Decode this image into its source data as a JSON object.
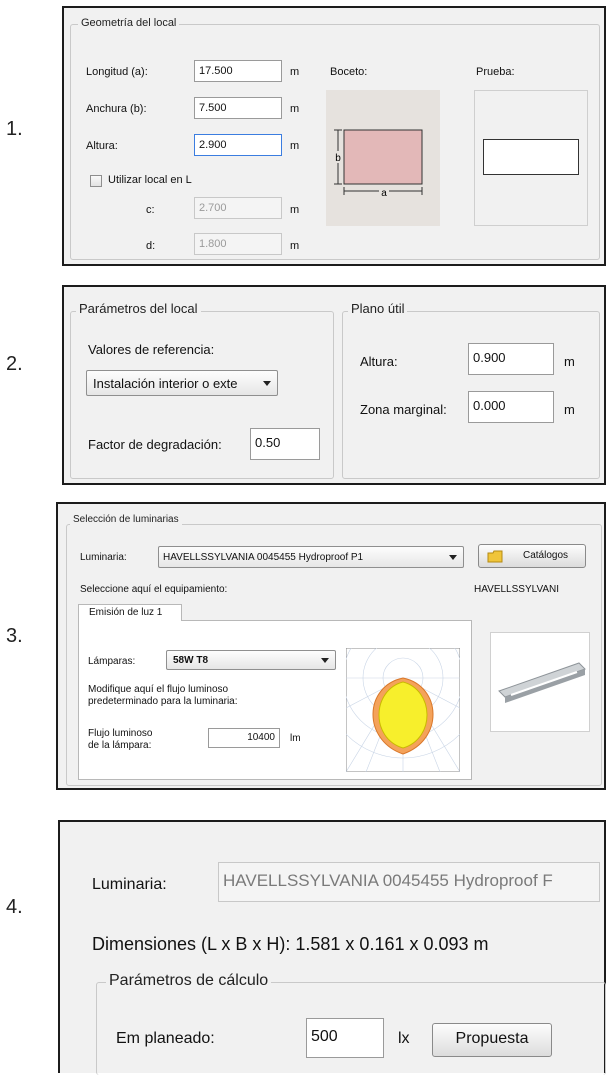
{
  "labels": {
    "n1": "1.",
    "n2": "2.",
    "n3": "3.",
    "n4": "4."
  },
  "s1": {
    "group_title": "Geometría del local",
    "longitud_label": "Longitud (a):",
    "longitud_value": "17.500",
    "anchura_label": "Anchura (b):",
    "anchura_value": "7.500",
    "altura_label": "Altura:",
    "altura_value": "2.900",
    "unit": "m",
    "local_l_label": "Utilizar local en L",
    "c_label": "c:",
    "c_value": "2.700",
    "d_label": "d:",
    "d_value": "1.800",
    "boceto_label": "Boceto:",
    "prueba_label": "Prueba:",
    "sketch_a": "a",
    "sketch_b": "b"
  },
  "s2": {
    "params_title": "Parámetros del local",
    "ref_label": "Valores de referencia:",
    "ref_value": "Instalación interior o exte",
    "factor_label": "Factor de degradación:",
    "factor_value": "0.50",
    "plano_title": "Plano útil",
    "altura_label": "Altura:",
    "altura_value": "0.900",
    "zona_label": "Zona marginal:",
    "zona_value": "0.000",
    "unit": "m"
  },
  "s3": {
    "group_title": "Selección de luminarias",
    "luminaria_label": "Luminaria:",
    "luminaria_value": "HAVELLSSYLVANIA 0045455 Hydroproof P1",
    "catalogos_label": "Catálogos",
    "select_hint": "Seleccione aquí el equipamiento:",
    "brand": "HAVELLSSYLVANI",
    "tab_label": "Emisión de luz 1",
    "lamparas_label": "Lámparas:",
    "lamparas_value": "58W T8",
    "modify_hint_1": "Modifique aquí el flujo luminoso",
    "modify_hint_2": "predeterminado para la luminaria:",
    "flujo_label_1": "Flujo luminoso",
    "flujo_label_2": "de la lámpara:",
    "flujo_value": "10400",
    "flujo_unit": "lm"
  },
  "s4": {
    "luminaria_label": "Luminaria:",
    "luminaria_value": "HAVELLSSYLVANIA 0045455 Hydroproof F",
    "dimensions": "Dimensiones (L x B x H): 1.581 x 0.161 x 0.093 m",
    "calc_title": "Parámetros de cálculo",
    "em_label": "Em planeado:",
    "em_value": "500",
    "em_unit": "lx",
    "propuesta_label": "Propuesta"
  }
}
